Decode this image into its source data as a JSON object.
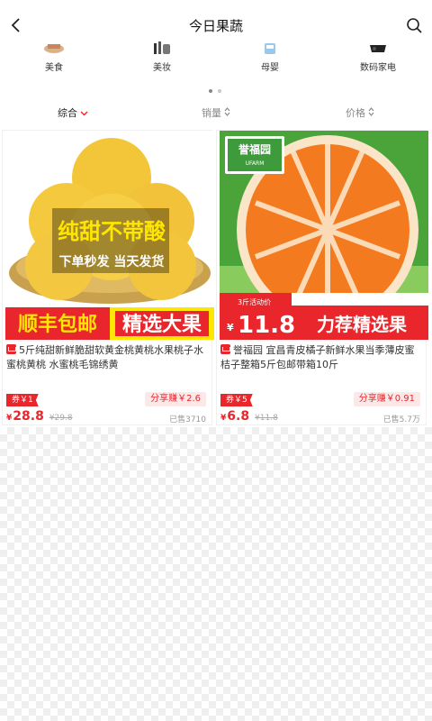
{
  "header": {
    "title": "今日果蔬"
  },
  "categories": [
    {
      "label": "美食",
      "icon": "food-thumb"
    },
    {
      "label": "美妆",
      "icon": "cosmetics-thumb"
    },
    {
      "label": "母婴",
      "icon": "baby-thumb"
    },
    {
      "label": "数码家电",
      "icon": "electronics-thumb"
    }
  ],
  "pager": {
    "pages": 2,
    "current": 1
  },
  "sort": {
    "comprehensive": "综合",
    "sales": "销量",
    "price": "价格"
  },
  "products": [
    {
      "banner_main": "纯甜不带酸",
      "banner_sub": "下单秒发 当天发货",
      "banner_left": "顺丰包邮",
      "banner_right": "精选大果",
      "title": "5斤纯甜新鲜脆甜软黄金桃黄桃水果桃子水蜜桃黄桃 水蜜桃毛锦绣黄",
      "coupon": "券￥1",
      "share": "分享赚￥2.6",
      "currency": "¥",
      "price": "28.8",
      "original": "¥29.8",
      "sold": "已售3710"
    },
    {
      "brand": "誉福园",
      "brand_sub": "UFARM",
      "promo_badge": "3斤活动价",
      "currency": "¥",
      "banner_price": "11.8",
      "banner_slogan": "力荐精选果",
      "title": "誉福园 宜昌青皮橘子新鲜水果当季薄皮蜜桔子整箱5斤包邮带箱10斤",
      "coupon": "券￥5",
      "share": "分享赚￥0.91",
      "price": "6.8",
      "original": "¥11.8",
      "sold": "已售5.7万"
    }
  ],
  "colors": {
    "accent": "#e8262b",
    "banner_yellow": "#ffe600",
    "banner_red": "#e8262b"
  }
}
